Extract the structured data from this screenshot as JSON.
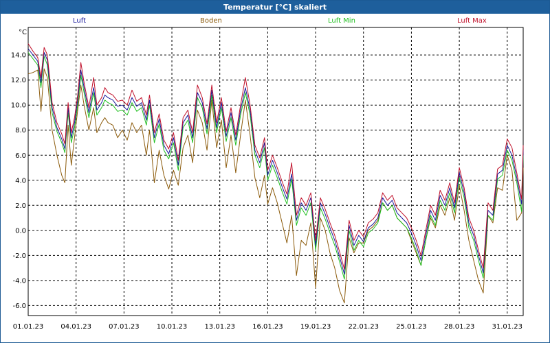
{
  "window": {
    "title": "Temperatur [°C] skaliert"
  },
  "colors": {
    "luft": "#1a1a9c",
    "boden": "#8b5a0a",
    "luft_min": "#1fbf1f",
    "luft_max": "#c0102a",
    "grid": "#000000",
    "frame": "#1e5f9c"
  },
  "chart_data": {
    "type": "line",
    "title": "Temperatur [°C] skaliert",
    "ylabel": "°C",
    "xlabel": "",
    "ylim": [
      -6.8,
      16.2
    ],
    "xlim": [
      "01.01.23",
      "01.02.23"
    ],
    "yticks": [
      14.0,
      12.0,
      10.0,
      8.0,
      6.0,
      4.0,
      2.0,
      0.0,
      -2.0,
      -4.0,
      -6.0
    ],
    "ytick_labels": [
      "14.0",
      "12.0",
      "10.0",
      "8.0",
      "6.0",
      "4.0",
      "2.0",
      "0.0",
      "-2.0",
      "-4.0",
      "-6.0"
    ],
    "xtick_labels": [
      "01.01.23",
      "04.01.23",
      "07.01.23",
      "10.01.23",
      "13.01.23",
      "16.01.23",
      "19.01.23",
      "22.01.23",
      "25.01.23",
      "28.01.23",
      "31.01.23"
    ],
    "xtick_days": [
      1,
      4,
      7,
      10,
      13,
      16,
      19,
      22,
      25,
      28,
      31
    ],
    "grid": true,
    "legend_position": "top",
    "series": [
      {
        "name": "Luft",
        "color_key": "luft",
        "x": [
          1.0,
          1.3,
          1.6,
          1.8,
          2.0,
          2.2,
          2.5,
          2.8,
          3.1,
          3.3,
          3.5,
          3.7,
          3.9,
          4.1,
          4.3,
          4.5,
          4.8,
          5.1,
          5.3,
          5.6,
          5.8,
          6.0,
          6.3,
          6.6,
          6.9,
          7.2,
          7.5,
          7.8,
          8.1,
          8.4,
          8.6,
          8.9,
          9.2,
          9.5,
          9.8,
          10.1,
          10.4,
          10.7,
          11.0,
          11.3,
          11.6,
          11.9,
          12.2,
          12.5,
          12.8,
          13.1,
          13.4,
          13.7,
          14.0,
          14.3,
          14.6,
          14.9,
          15.2,
          15.5,
          15.8,
          16.0,
          16.3,
          16.6,
          16.9,
          17.2,
          17.5,
          17.8,
          18.1,
          18.4,
          18.7,
          19.0,
          19.3,
          19.6,
          19.9,
          20.2,
          20.5,
          20.8,
          21.1,
          21.4,
          21.7,
          22.0,
          22.3,
          22.6,
          22.9,
          23.2,
          23.5,
          23.8,
          24.1,
          24.4,
          24.7,
          25.0,
          25.3,
          25.6,
          25.9,
          26.2,
          26.5,
          26.8,
          27.1,
          27.4,
          27.7,
          28.0,
          28.3,
          28.6,
          28.9,
          29.2,
          29.5,
          29.8,
          30.1,
          30.4,
          30.7,
          31.0,
          31.3,
          31.6,
          31.9,
          32.0
        ],
        "y": [
          14.5,
          14.0,
          13.5,
          11.8,
          14.2,
          13.6,
          9.8,
          8.2,
          7.3,
          6.5,
          9.8,
          7.4,
          8.6,
          10.4,
          12.8,
          11.4,
          9.4,
          11.4,
          9.6,
          10.2,
          10.8,
          10.6,
          10.4,
          9.9,
          10.0,
          9.6,
          10.6,
          9.9,
          10.2,
          8.8,
          10.4,
          7.4,
          8.9,
          6.8,
          6.1,
          7.4,
          5.2,
          8.6,
          9.2,
          7.4,
          11.0,
          10.2,
          8.1,
          11.2,
          8.2,
          10.2,
          7.5,
          9.4,
          7.2,
          9.6,
          11.4,
          9.6,
          6.4,
          5.4,
          7.0,
          4.4,
          5.6,
          4.6,
          3.5,
          2.5,
          4.5,
          0.8,
          2.2,
          1.6,
          2.6,
          -1.2,
          2.2,
          1.3,
          0.2,
          -0.8,
          -2.1,
          -3.5,
          0.4,
          -1.2,
          -0.4,
          -0.9,
          0.2,
          0.5,
          1.0,
          2.6,
          2.0,
          2.4,
          1.4,
          1.0,
          0.6,
          -0.2,
          -1.2,
          -2.4,
          -0.4,
          1.6,
          0.8,
          2.8,
          2.0,
          3.4,
          1.8,
          4.6,
          3.0,
          0.6,
          -0.4,
          -2.0,
          -3.4,
          1.6,
          1.2,
          4.5,
          4.8,
          6.8,
          6.0,
          4.2,
          2.1,
          6.4
        ]
      },
      {
        "name": "Boden",
        "color_key": "boden",
        "x": [
          1.0,
          1.3,
          1.6,
          1.8,
          2.0,
          2.2,
          2.5,
          2.8,
          3.1,
          3.3,
          3.5,
          3.7,
          3.9,
          4.1,
          4.3,
          4.5,
          4.8,
          5.1,
          5.3,
          5.6,
          5.8,
          6.0,
          6.3,
          6.6,
          6.9,
          7.2,
          7.5,
          7.8,
          8.1,
          8.4,
          8.6,
          8.9,
          9.2,
          9.5,
          9.8,
          10.1,
          10.4,
          10.7,
          11.0,
          11.3,
          11.6,
          11.9,
          12.2,
          12.5,
          12.8,
          13.1,
          13.4,
          13.7,
          14.0,
          14.3,
          14.6,
          14.9,
          15.2,
          15.5,
          15.8,
          16.0,
          16.3,
          16.6,
          16.9,
          17.2,
          17.5,
          17.8,
          18.1,
          18.4,
          18.7,
          19.0,
          19.3,
          19.6,
          19.9,
          20.2,
          20.5,
          20.8,
          21.1,
          21.4,
          21.7,
          22.0,
          22.3,
          22.6,
          22.9,
          23.2,
          23.5,
          23.8,
          24.1,
          24.4,
          24.7,
          25.0,
          25.3,
          25.6,
          25.9,
          26.2,
          26.5,
          26.8,
          27.1,
          27.4,
          27.7,
          28.0,
          28.3,
          28.6,
          28.9,
          29.2,
          29.5,
          29.8,
          30.1,
          30.4,
          30.7,
          31.0,
          31.3,
          31.6,
          31.9,
          32.0
        ],
        "y": [
          12.5,
          12.6,
          12.8,
          9.5,
          12.9,
          12.2,
          8.0,
          6.0,
          4.4,
          3.8,
          8.4,
          5.2,
          7.4,
          9.6,
          11.6,
          10.0,
          8.0,
          9.8,
          7.8,
          8.6,
          9.0,
          8.6,
          8.4,
          7.4,
          8.0,
          7.2,
          8.6,
          7.8,
          8.4,
          6.0,
          8.0,
          3.8,
          6.4,
          4.4,
          3.3,
          4.8,
          3.6,
          6.6,
          7.6,
          5.4,
          9.6,
          8.6,
          6.4,
          10.4,
          6.6,
          8.8,
          5.0,
          7.6,
          4.6,
          7.6,
          10.4,
          7.6,
          4.2,
          2.6,
          4.4,
          2.1,
          3.4,
          2.2,
          0.6,
          -1.0,
          1.2,
          -3.6,
          -0.8,
          -1.2,
          0.6,
          -4.6,
          1.0,
          0.0,
          -1.8,
          -3.0,
          -4.8,
          -5.8,
          -0.6,
          -1.8,
          -1.0,
          -1.0,
          0.0,
          0.3,
          0.8,
          2.2,
          1.6,
          2.0,
          1.0,
          0.6,
          0.2,
          -0.8,
          -1.8,
          -2.8,
          -0.8,
          1.0,
          0.2,
          2.0,
          1.2,
          2.6,
          0.8,
          3.6,
          1.6,
          -0.8,
          -2.4,
          -4.0,
          -5.0,
          1.2,
          0.6,
          3.4,
          3.2,
          6.0,
          4.8,
          0.8,
          1.4,
          5.0
        ]
      },
      {
        "name": "Luft Min",
        "color_key": "luft_min",
        "x": [
          1.0,
          1.3,
          1.6,
          1.8,
          2.0,
          2.2,
          2.5,
          2.8,
          3.1,
          3.3,
          3.5,
          3.7,
          3.9,
          4.1,
          4.3,
          4.5,
          4.8,
          5.1,
          5.3,
          5.6,
          5.8,
          6.0,
          6.3,
          6.6,
          6.9,
          7.2,
          7.5,
          7.8,
          8.1,
          8.4,
          8.6,
          8.9,
          9.2,
          9.5,
          9.8,
          10.1,
          10.4,
          10.7,
          11.0,
          11.3,
          11.6,
          11.9,
          12.2,
          12.5,
          12.8,
          13.1,
          13.4,
          13.7,
          14.0,
          14.3,
          14.6,
          14.9,
          15.2,
          15.5,
          15.8,
          16.0,
          16.3,
          16.6,
          16.9,
          17.2,
          17.5,
          17.8,
          18.1,
          18.4,
          18.7,
          19.0,
          19.3,
          19.6,
          19.9,
          20.2,
          20.5,
          20.8,
          21.1,
          21.4,
          21.7,
          22.0,
          22.3,
          22.6,
          22.9,
          23.2,
          23.5,
          23.8,
          24.1,
          24.4,
          24.7,
          25.0,
          25.3,
          25.6,
          25.9,
          26.2,
          26.5,
          26.8,
          27.1,
          27.4,
          27.7,
          28.0,
          28.3,
          28.6,
          28.9,
          29.2,
          29.5,
          29.8,
          30.1,
          30.4,
          30.7,
          31.0,
          31.3,
          31.6,
          31.9,
          32.0
        ],
        "y": [
          14.2,
          13.7,
          13.2,
          11.4,
          13.9,
          13.2,
          9.4,
          7.9,
          7.0,
          6.2,
          9.4,
          7.0,
          8.2,
          10.0,
          12.4,
          11.0,
          9.0,
          11.0,
          9.2,
          9.8,
          10.4,
          10.2,
          10.0,
          9.5,
          9.6,
          9.2,
          10.2,
          9.5,
          9.8,
          8.4,
          10.0,
          7.0,
          8.5,
          6.4,
          5.7,
          7.0,
          4.8,
          8.2,
          8.8,
          7.0,
          10.6,
          9.8,
          7.7,
          10.8,
          7.8,
          9.8,
          7.1,
          9.0,
          6.8,
          9.2,
          11.0,
          9.2,
          6.0,
          5.0,
          6.6,
          4.0,
          5.2,
          4.2,
          3.1,
          2.1,
          4.1,
          0.4,
          1.8,
          1.2,
          2.2,
          -1.6,
          1.8,
          0.9,
          -0.2,
          -1.2,
          -2.5,
          -3.9,
          0.0,
          -1.6,
          -0.8,
          -1.3,
          -0.2,
          0.1,
          0.6,
          2.2,
          1.6,
          2.0,
          1.0,
          0.6,
          0.2,
          -0.6,
          -1.6,
          -2.8,
          -0.8,
          1.2,
          0.4,
          2.4,
          1.6,
          3.0,
          1.4,
          4.2,
          2.6,
          0.2,
          -0.8,
          -2.4,
          -3.8,
          1.2,
          0.8,
          4.1,
          4.4,
          6.4,
          5.6,
          3.8,
          1.5,
          6.0
        ]
      },
      {
        "name": "Luft Max",
        "color_key": "luft_max",
        "x": [
          1.0,
          1.3,
          1.6,
          1.8,
          2.0,
          2.2,
          2.5,
          2.8,
          3.1,
          3.3,
          3.5,
          3.7,
          3.9,
          4.1,
          4.3,
          4.5,
          4.8,
          5.1,
          5.3,
          5.6,
          5.8,
          6.0,
          6.3,
          6.6,
          6.9,
          7.2,
          7.5,
          7.8,
          8.1,
          8.4,
          8.6,
          8.9,
          9.2,
          9.5,
          9.8,
          10.1,
          10.4,
          10.7,
          11.0,
          11.3,
          11.6,
          11.9,
          12.2,
          12.5,
          12.8,
          13.1,
          13.4,
          13.7,
          14.0,
          14.3,
          14.6,
          14.9,
          15.2,
          15.5,
          15.8,
          16.0,
          16.3,
          16.6,
          16.9,
          17.2,
          17.5,
          17.8,
          18.1,
          18.4,
          18.7,
          19.0,
          19.3,
          19.6,
          19.9,
          20.2,
          20.5,
          20.8,
          21.1,
          21.4,
          21.7,
          22.0,
          22.3,
          22.6,
          22.9,
          23.2,
          23.5,
          23.8,
          24.1,
          24.4,
          24.7,
          25.0,
          25.3,
          25.6,
          25.9,
          26.2,
          26.5,
          26.8,
          27.1,
          27.4,
          27.7,
          28.0,
          28.3,
          28.6,
          28.9,
          29.2,
          29.5,
          29.8,
          30.1,
          30.4,
          30.7,
          31.0,
          31.3,
          31.6,
          31.9,
          32.0
        ],
        "y": [
          14.9,
          14.3,
          13.8,
          12.2,
          14.6,
          14.0,
          10.2,
          8.6,
          7.7,
          6.9,
          10.2,
          7.8,
          9.0,
          10.8,
          13.4,
          11.8,
          9.8,
          12.2,
          10.0,
          10.6,
          11.4,
          11.0,
          10.8,
          10.3,
          10.4,
          10.0,
          11.2,
          10.3,
          10.6,
          9.2,
          10.8,
          7.8,
          9.3,
          7.2,
          6.5,
          7.8,
          5.6,
          9.0,
          9.6,
          7.8,
          11.6,
          10.6,
          8.5,
          11.6,
          8.6,
          10.6,
          7.9,
          9.8,
          7.6,
          10.0,
          12.2,
          10.0,
          6.8,
          5.8,
          7.4,
          4.8,
          6.0,
          5.0,
          3.9,
          2.9,
          5.4,
          1.2,
          2.6,
          2.0,
          3.0,
          -0.8,
          2.6,
          1.7,
          0.6,
          -0.4,
          -1.7,
          -3.1,
          0.8,
          -0.8,
          0.0,
          -0.5,
          0.6,
          0.9,
          1.4,
          3.0,
          2.4,
          2.8,
          1.8,
          1.4,
          1.0,
          0.2,
          -0.8,
          -2.0,
          0.0,
          2.0,
          1.2,
          3.2,
          2.4,
          3.8,
          2.2,
          5.0,
          3.4,
          1.0,
          0.0,
          -1.6,
          -3.0,
          2.2,
          1.6,
          4.9,
          5.2,
          7.3,
          6.6,
          4.6,
          2.5,
          6.8
        ]
      }
    ]
  }
}
